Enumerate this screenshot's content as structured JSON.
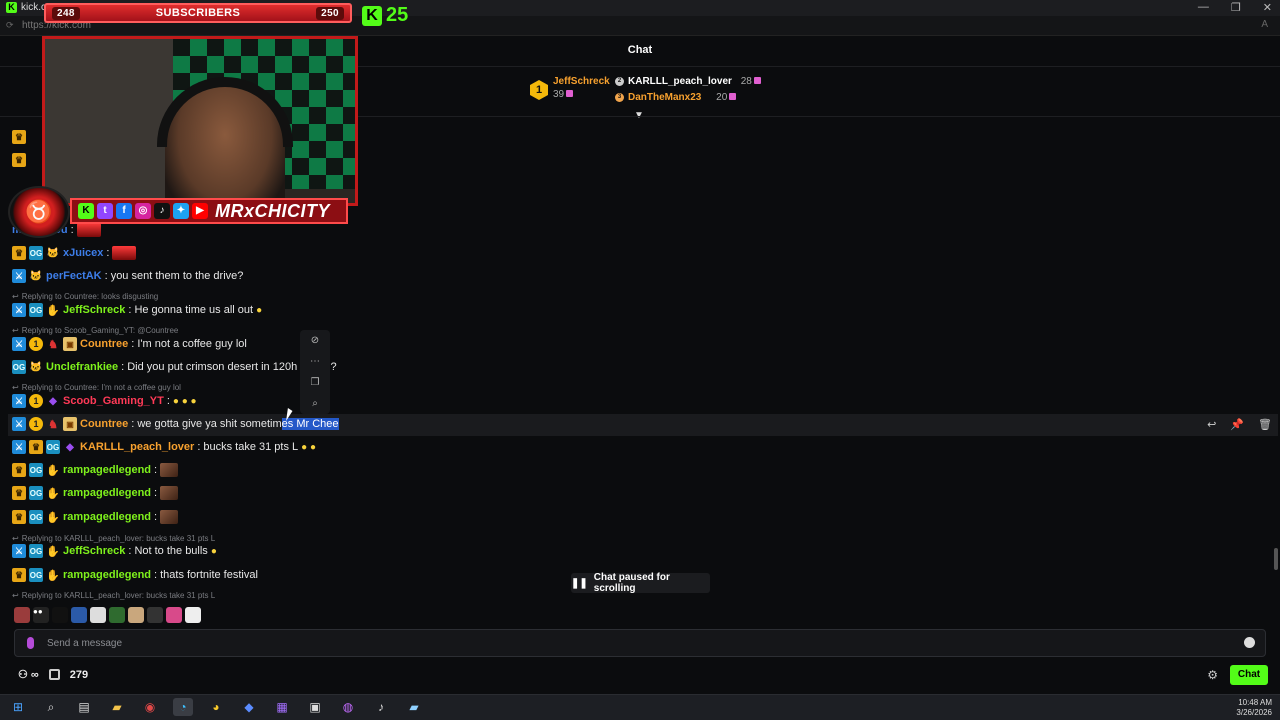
{
  "browser": {
    "tab_title": "kick.com",
    "url": "https://kick.com",
    "window_controls": [
      "—",
      "❐",
      "✕"
    ]
  },
  "overlay": {
    "sub_current": "248",
    "sub_label": "SUBSCRIBERS",
    "sub_goal": "250",
    "kick_count": "25",
    "channel_name": "MRxCHICITY",
    "social_icons": [
      "kick",
      "twitch",
      "facebook",
      "instagram",
      "tiktok",
      "twitter",
      "youtube"
    ]
  },
  "chat": {
    "title": "Chat",
    "leaderboard": {
      "first": {
        "rank": "1",
        "name": "JeffSchreck",
        "value": "39"
      },
      "second": {
        "name": "KARLLL_peach_lover",
        "value": "28"
      },
      "third": {
        "name": "DanTheManx23",
        "value": "20"
      }
    },
    "messages": [
      {
        "user": "morty500u",
        "text": "",
        "color": "blue"
      },
      {
        "user": "xJuicex",
        "text": "",
        "color": "blue"
      },
      {
        "user": "perFectAK",
        "text": "you sent them to the drive?",
        "color": "blue"
      },
      {
        "reply": "Replying to Countree: looks disgusting"
      },
      {
        "user": "JeffSchreck",
        "text": "He gonna time us all out",
        "color": "green"
      },
      {
        "reply": "Replying to Scoob_Gaming_YT: @Countree"
      },
      {
        "user": "Countree",
        "text": "I'm not a coffee guy lol",
        "color": "orange"
      },
      {
        "user": "Unclefrankiee",
        "text": "Did you put crimson desert in 120h",
        "text_tail": "de?",
        "color": "green"
      },
      {
        "reply": "Replying to Countree: I'm not a coffee guy lol"
      },
      {
        "user": "Scoob_Gaming_YT",
        "text": "",
        "color": "red"
      },
      {
        "user": "Countree",
        "text": "we gotta give ya shit sometim",
        "selected_text": "es Mr Chee",
        "color": "orange"
      },
      {
        "user": "KARLLL_peach_lover",
        "text": "bucks take 31 pts L",
        "color": "orange"
      },
      {
        "user": "rampagedlegend",
        "text": "",
        "color": "green"
      },
      {
        "user": "rampagedlegend",
        "text": "",
        "color": "green"
      },
      {
        "user": "rampagedlegend",
        "text": "",
        "color": "green"
      },
      {
        "reply": "Replying to KARLLL_peach_lover: bucks take 31 pts L"
      },
      {
        "user": "JeffSchreck",
        "text": "Not to the bulls",
        "color": "green"
      },
      {
        "user": "rampagedlegend",
        "text": "thats fortnite festival",
        "color": "green"
      },
      {
        "reply": "Replying to KARLLL_peach_lover: bucks take 31 pts L"
      }
    ],
    "paused_label": "Chat paused for scrolling",
    "input_placeholder": "Send a message",
    "points": "279",
    "chat_button": "Chat"
  },
  "taskbar": {
    "time": "10:48 AM",
    "date": "3/26/2026"
  },
  "colors": {
    "kick_green": "#53fc18",
    "overlay_red": "#c21a1a",
    "selection": "#2458c8"
  }
}
